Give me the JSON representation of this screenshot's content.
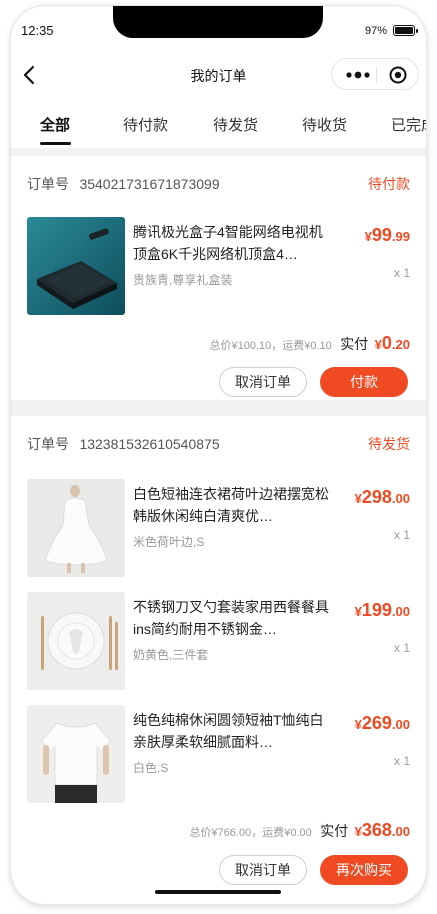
{
  "status_bar": {
    "time": "12:35",
    "battery": "97%"
  },
  "nav": {
    "title": "我的订单"
  },
  "tabs": [
    {
      "label": "全部",
      "active": true
    },
    {
      "label": "待付款"
    },
    {
      "label": "待发货"
    },
    {
      "label": "待收货"
    },
    {
      "label": "已完成"
    }
  ],
  "orders": [
    {
      "order_no_label": "订单号",
      "order_no": "354021731671873099",
      "status": "待付款",
      "items": [
        {
          "title": "腾讯极光盒子4智能网络电视机顶盒6K千兆网络机顶盒4…",
          "spec": "贵族青,尊享礼盒装",
          "price_currency": "¥",
          "price_int": "99",
          "price_dec": ".99",
          "qty": "x 1",
          "thumb_icon": "tv-box-image"
        }
      ],
      "summary": {
        "total_text": "总价¥100.10，运费¥0.10",
        "paid_label": "实付",
        "paid_currency": "¥",
        "paid_int": "0",
        "paid_dec": ".20"
      },
      "buttons": {
        "secondary": "取消订单",
        "primary": "付款"
      }
    },
    {
      "order_no_label": "订单号",
      "order_no": "132381532610540875",
      "status": "待发货",
      "items": [
        {
          "title": "白色短袖连衣裙荷叶边裙摆宽松韩版休闲纯白清爽优…",
          "spec": "米色荷叶边,S",
          "price_currency": "¥",
          "price_int": "298",
          "price_dec": ".00",
          "qty": "x 1",
          "thumb_icon": "white-dress-image"
        },
        {
          "title": "不锈钢刀叉勺套装家用西餐餐具ins简约耐用不锈钢金…",
          "spec": "奶黄色,三件套",
          "price_currency": "¥",
          "price_int": "199",
          "price_dec": ".00",
          "qty": "x 1",
          "thumb_icon": "cutlery-set-image"
        },
        {
          "title": "纯色纯棉休闲圆领短袖T恤纯白亲肤厚柔软细腻面料…",
          "spec": "白色,S",
          "price_currency": "¥",
          "price_int": "269",
          "price_dec": ".00",
          "qty": "x 1",
          "thumb_icon": "white-tshirt-image"
        }
      ],
      "summary": {
        "total_text": "总价¥766.00，运费¥0.00",
        "paid_label": "实付",
        "paid_currency": "¥",
        "paid_int": "368",
        "paid_dec": ".00"
      },
      "buttons": {
        "secondary": "取消订单",
        "primary": "再次购买"
      }
    }
  ],
  "colors": {
    "accent": "#f04a23",
    "background": "#f2f2f2"
  }
}
